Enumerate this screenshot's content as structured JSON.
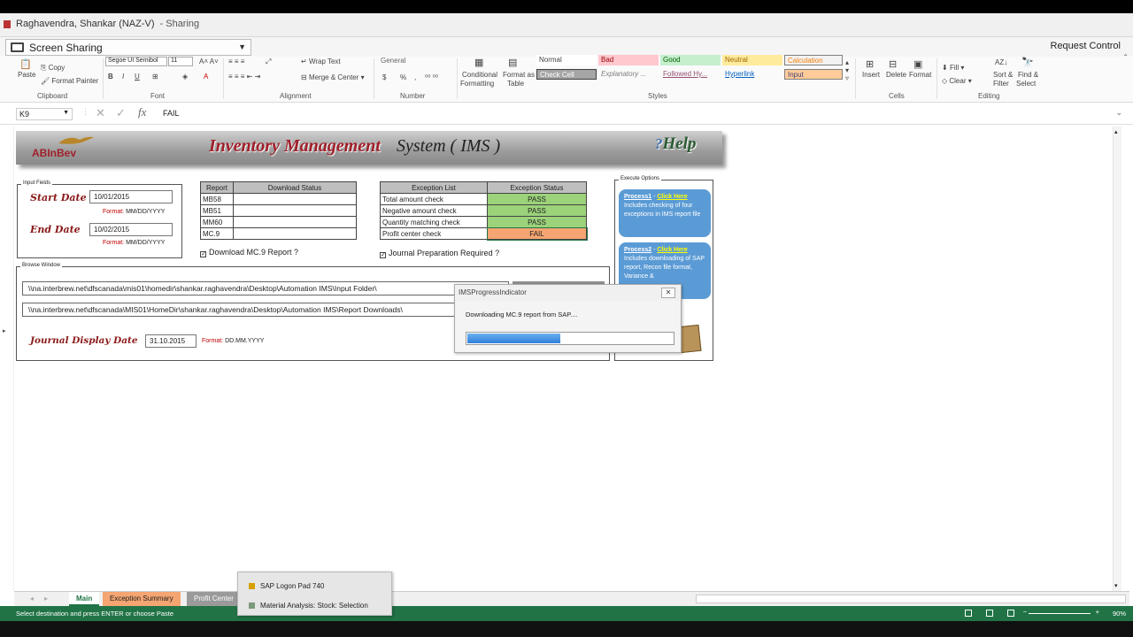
{
  "window": {
    "title": "Raghavendra, Shankar (NAZ-V)",
    "subtitle": "- Sharing"
  },
  "sharing": {
    "dropdown_label": "Screen Sharing",
    "request_control": "Request Control"
  },
  "ribbon": {
    "clipboard": {
      "paste": "Paste",
      "copy": "Copy",
      "format_painter": "Format Painter",
      "group": "Clipboard"
    },
    "font": {
      "name": "Segoe UI Semibol",
      "size": "11",
      "bold": "B",
      "italic": "I",
      "underline": "U",
      "group": "Font"
    },
    "alignment": {
      "wrap": "Wrap Text",
      "merge": "Merge & Center",
      "group": "Alignment"
    },
    "number": {
      "format": "General",
      "currency": "$",
      "percent": "%",
      "comma": ",",
      "group": "Number"
    },
    "styles": {
      "conditional": "Conditional",
      "formatting": "Formatting",
      "format_as": "Format as",
      "table": "Table",
      "cells": [
        "Normal",
        "Bad",
        "Good",
        "Neutral",
        "Calculation",
        "Check Cell",
        "Explanatory ...",
        "Followed Hy...",
        "Hyperlink",
        "Input"
      ],
      "group": "Styles"
    },
    "cells": {
      "insert": "Insert",
      "delete": "Delete",
      "format": "Format",
      "group": "Cells"
    },
    "editing": {
      "fill": "Fill",
      "clear": "Clear",
      "sort": "Sort &",
      "filter": "Filter",
      "find": "Find &",
      "select": "Select",
      "group": "Editing"
    }
  },
  "formula_bar": {
    "cell_ref": "K9",
    "value": "FAIL"
  },
  "ims": {
    "brand": "ABInBev",
    "title_part1": "Inventory Management",
    "title_part2": "System ( IMS )",
    "help": "Help",
    "input_fields": {
      "legend": "Input Fields",
      "start_label": "Start Date",
      "start_value": "10/01/2015",
      "end_label": "End Date",
      "end_value": "10/02/2015",
      "format_label": "Format:",
      "format_value": "MM/DD/YYYY"
    },
    "report_table": {
      "headers": [
        "Report",
        "Download Status"
      ],
      "rows": [
        "MB58",
        "MB51",
        "MM60",
        "MC.9"
      ]
    },
    "exception_table": {
      "headers": [
        "Exception List",
        "Exception Status"
      ],
      "rows": [
        {
          "name": "Total amount check",
          "status": "PASS"
        },
        {
          "name": "Negative amount check",
          "status": "PASS"
        },
        {
          "name": "Quantity matching check",
          "status": "PASS"
        },
        {
          "name": "Profit center check",
          "status": "FAIL"
        }
      ]
    },
    "download_mc9": "Download MC.9 Report ?",
    "journal_prep": "Journal Preparation Required ?",
    "browse": {
      "legend": "Browse Window",
      "path1": "\\\\na.interbrew.net\\dfscanada\\mis01\\homedir\\shankar.raghavendra\\Desktop\\Automation IMS\\Input Folder\\",
      "path2": "\\\\na.interbrew.net\\dfscanada\\MIS01\\HomeDir\\shankar.raghavendra\\Desktop\\Automation IMS\\Report Downloads\\",
      "journal_label": "Journal Display Date",
      "journal_value": "31.10.2015",
      "journal_format_label": "Format:",
      "journal_format_value": "DD.MM.YYYY"
    },
    "execute": {
      "legend": "Execute Options",
      "p1_name": "Process1",
      "p1_click": "Click Here",
      "p1_desc": "Includes checking of four exceptions in IMS report file",
      "p2_name": "Process2",
      "p2_click": "Click Here",
      "p2_desc": "Includes downloading of SAP report, Recon file format, Variance &"
    }
  },
  "dialog": {
    "title": "IMSProgressIndicator",
    "message": "Downloading MC.9 report from SAP....",
    "progress": 0.45
  },
  "tabs": {
    "main": "Main",
    "exception": "Exception Summary",
    "profit": "Profit Center"
  },
  "status_bar": {
    "message": "Select destination and press ENTER or choose Paste",
    "zoom": "90%"
  },
  "popup": {
    "items": [
      "SAP Logon Pad 740",
      "Material Analysis: Stock: Selection"
    ]
  },
  "colors": {
    "pass": "#9bd27a",
    "fail": "#f4a571",
    "status_bar": "#217346",
    "process_button": "#5b9bd5",
    "title_red": "#a0202a"
  }
}
